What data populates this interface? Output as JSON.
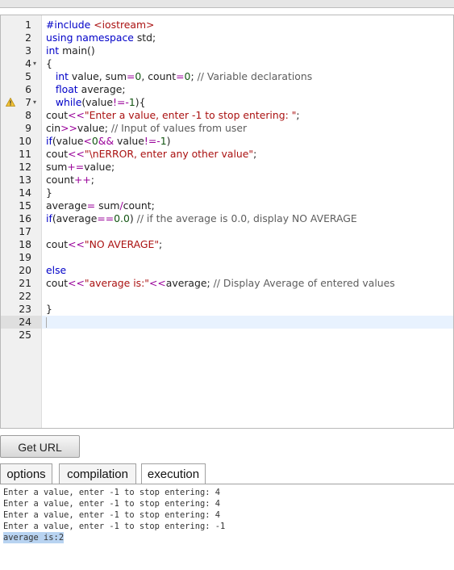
{
  "editor": {
    "active_line": 24,
    "warning_line": 7,
    "fold_lines": [
      4,
      7
    ],
    "lines": [
      {
        "n": "1",
        "tokens": [
          [
            "p",
            "#include "
          ],
          [
            "s",
            "<iostream>"
          ]
        ]
      },
      {
        "n": "2",
        "tokens": [
          [
            "k",
            "using namespace "
          ],
          [
            "",
            "std;"
          ]
        ]
      },
      {
        "n": "3",
        "tokens": [
          [
            "t",
            "int "
          ],
          [
            "",
            "main()"
          ]
        ]
      },
      {
        "n": "4",
        "tokens": [
          [
            "",
            "{"
          ]
        ]
      },
      {
        "n": "5",
        "tokens": [
          [
            "",
            "   "
          ],
          [
            "t",
            "int "
          ],
          [
            "",
            "value, sum"
          ],
          [
            "o",
            "="
          ],
          [
            "n",
            "0"
          ],
          [
            "",
            ", count"
          ],
          [
            "o",
            "="
          ],
          [
            "n",
            "0"
          ],
          [
            "",
            "; "
          ],
          [
            "c",
            "// Variable declarations"
          ]
        ]
      },
      {
        "n": "6",
        "tokens": [
          [
            "",
            "   "
          ],
          [
            "t",
            "float "
          ],
          [
            "",
            "average;"
          ]
        ]
      },
      {
        "n": "7",
        "tokens": [
          [
            "",
            "   "
          ],
          [
            "k",
            "while"
          ],
          [
            "",
            "(value"
          ],
          [
            "o",
            "!="
          ],
          [
            "o",
            "-"
          ],
          [
            "n",
            "1"
          ],
          [
            "",
            ")"
          ],
          [
            "",
            "{"
          ]
        ]
      },
      {
        "n": "8",
        "tokens": [
          [
            "",
            "cout"
          ],
          [
            "o",
            "<<"
          ],
          [
            "s",
            "\"Enter a value, enter -1 to stop entering: \""
          ],
          [
            "",
            ";"
          ]
        ]
      },
      {
        "n": "9",
        "tokens": [
          [
            "",
            "cin"
          ],
          [
            "o",
            ">>"
          ],
          [
            "",
            "value; "
          ],
          [
            "c",
            "// Input of values from user"
          ]
        ]
      },
      {
        "n": "10",
        "tokens": [
          [
            "k",
            "if"
          ],
          [
            "",
            "(value"
          ],
          [
            "o",
            "<"
          ],
          [
            "n",
            "0"
          ],
          [
            "o",
            "&&"
          ],
          [
            "",
            " value"
          ],
          [
            "o",
            "!="
          ],
          [
            "o",
            "-"
          ],
          [
            "n",
            "1"
          ],
          [
            "",
            ")"
          ]
        ]
      },
      {
        "n": "11",
        "tokens": [
          [
            "",
            "cout"
          ],
          [
            "o",
            "<<"
          ],
          [
            "s",
            "\"\\nERROR, enter any other value\""
          ],
          [
            "",
            ";"
          ]
        ]
      },
      {
        "n": "12",
        "tokens": [
          [
            "",
            "sum"
          ],
          [
            "o",
            "+="
          ],
          [
            "",
            "value;"
          ]
        ]
      },
      {
        "n": "13",
        "tokens": [
          [
            "",
            "count"
          ],
          [
            "o",
            "++"
          ],
          [
            "",
            ";"
          ]
        ]
      },
      {
        "n": "14",
        "tokens": [
          [
            "",
            "}"
          ]
        ]
      },
      {
        "n": "15",
        "tokens": [
          [
            "",
            "average"
          ],
          [
            "o",
            "="
          ],
          [
            "",
            " sum"
          ],
          [
            "o",
            "/"
          ],
          [
            "",
            "count;"
          ]
        ]
      },
      {
        "n": "16",
        "tokens": [
          [
            "k",
            "if"
          ],
          [
            "",
            "(average"
          ],
          [
            "o",
            "=="
          ],
          [
            "n",
            "0.0"
          ],
          [
            "",
            ") "
          ],
          [
            "c",
            "// if the average is 0.0, display NO AVERAGE"
          ]
        ]
      },
      {
        "n": "17",
        "tokens": []
      },
      {
        "n": "18",
        "tokens": [
          [
            "",
            "cout"
          ],
          [
            "o",
            "<<"
          ],
          [
            "s",
            "\"NO AVERAGE\""
          ],
          [
            "",
            ";"
          ]
        ]
      },
      {
        "n": "19",
        "tokens": []
      },
      {
        "n": "20",
        "tokens": [
          [
            "k",
            "else"
          ]
        ]
      },
      {
        "n": "21",
        "tokens": [
          [
            "",
            "cout"
          ],
          [
            "o",
            "<<"
          ],
          [
            "s",
            "\"average is:\""
          ],
          [
            "o",
            "<<"
          ],
          [
            "",
            "average; "
          ],
          [
            "c",
            "// Display Average of entered values"
          ]
        ]
      },
      {
        "n": "22",
        "tokens": []
      },
      {
        "n": "23",
        "tokens": [
          [
            "",
            "}"
          ]
        ]
      },
      {
        "n": "24",
        "tokens": []
      },
      {
        "n": "25",
        "tokens": []
      }
    ]
  },
  "toolbar": {
    "get_url_label": "Get URL"
  },
  "tabs": [
    {
      "label": "options",
      "active": false
    },
    {
      "label": "compilation",
      "active": false
    },
    {
      "label": "execution",
      "active": true
    }
  ],
  "output": {
    "lines": [
      {
        "text": "Enter a value, enter -1 to stop entering: 4",
        "selected": false
      },
      {
        "text": "Enter a value, enter -1 to stop entering: 4",
        "selected": false
      },
      {
        "text": "Enter a value, enter -1 to stop entering: 4",
        "selected": false
      },
      {
        "text": "Enter a value, enter -1 to stop entering: -1",
        "selected": false
      },
      {
        "text": "average is:2",
        "selected": true
      }
    ]
  },
  "colors": {
    "keyword": "#0000c8",
    "string": "#aa1111",
    "number": "#115511",
    "comment": "#5d5d5d",
    "operator": "#990099",
    "selection": "#b8d3f1",
    "active_line": "#e8f2fe"
  },
  "icons": {
    "warning": "warning-icon",
    "fold": "fold-arrow-icon"
  }
}
